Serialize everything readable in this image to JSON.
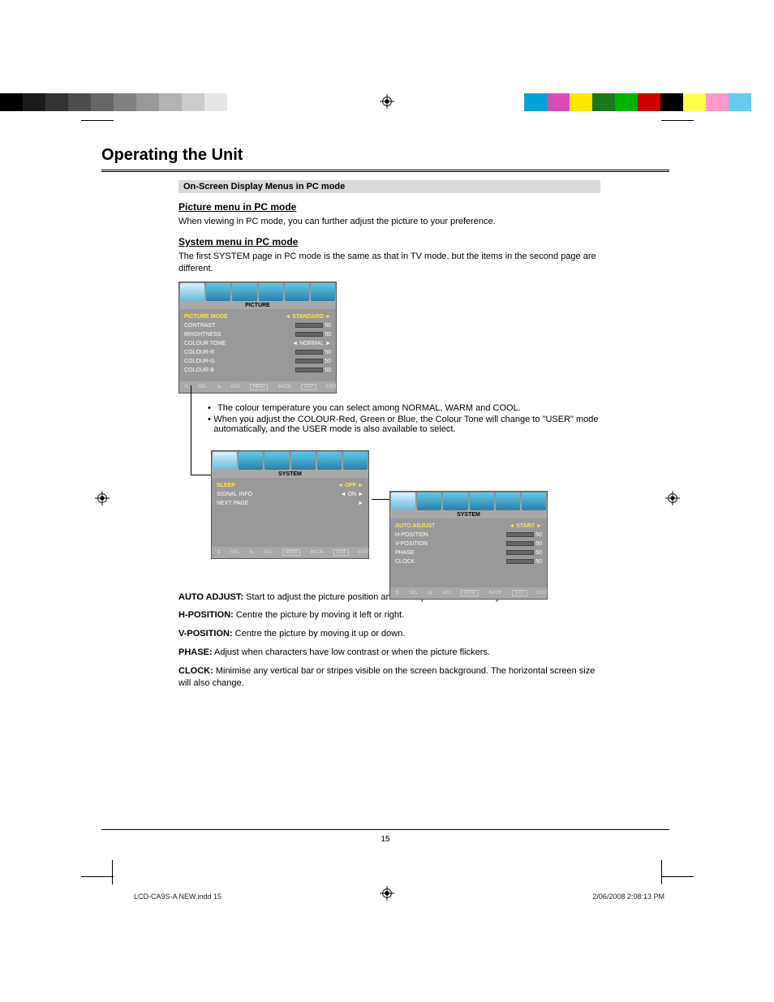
{
  "page": {
    "title": "Operating the Unit",
    "subtitle": "On-Screen Display Menus in PC mode",
    "section1": {
      "title": "Picture menu in PC mode",
      "intro": "When viewing in PC mode, you can further adjust the picture to your preference.",
      "osd": {
        "title": "PICTURE",
        "rows": [
          {
            "label": "PICTURE MODE",
            "type": "enum",
            "value": "STANDARD",
            "hl": true
          },
          {
            "label": "CONTRAST",
            "type": "slider",
            "value": "50"
          },
          {
            "label": "BRIGHTNESS",
            "type": "slider",
            "value": "50"
          },
          {
            "label": "COLOUR TONE",
            "type": "enum",
            "value": "NORMAL"
          },
          {
            "label": "COLOUR-R",
            "type": "slider",
            "value": "50"
          },
          {
            "label": "COLOUR-G",
            "type": "slider",
            "value": "50"
          },
          {
            "label": "COLOUR-B",
            "type": "slider",
            "value": "50"
          }
        ],
        "foot": [
          "SEL",
          "ADJ",
          "BACK",
          "EXIT"
        ],
        "footKeys": [
          "",
          "",
          "MENU",
          "EXIT"
        ]
      },
      "bullets": [
        "The colour temperature you can select among NORMAL, WARM and COOL.",
        "When you adjust the COLOUR-Red, Green or Blue, the Colour Tone will change to \"USER\" mode automatically, and the USER mode is also available to select."
      ]
    },
    "section2": {
      "title": "System menu in PC mode",
      "intro": "The first SYSTEM page in PC mode is the same as that in TV mode, but the items in the second page are different.",
      "osd2": {
        "title": "SYSTEM",
        "rows": [
          {
            "label": "SLEEP",
            "type": "enum",
            "value": "OFF",
            "hl": true
          },
          {
            "label": "SIGNAL INFO",
            "type": "enum",
            "value": "ON"
          },
          {
            "label": "NEXT PAGE",
            "type": "arrow",
            "value": ""
          }
        ],
        "foot": [
          "SEL",
          "ADJ",
          "BACK",
          "EXIT"
        ]
      },
      "osd3": {
        "title": "SYSTEM",
        "rows": [
          {
            "label": "AUTO ADJUST",
            "type": "enum",
            "value": "START",
            "hl": true
          },
          {
            "label": "H-POSITION",
            "type": "slider",
            "value": "50"
          },
          {
            "label": "V-POSITION",
            "type": "slider",
            "value": "50"
          },
          {
            "label": "PHASE",
            "type": "slider",
            "value": "50"
          },
          {
            "label": "CLOCK",
            "type": "slider",
            "value": "50"
          }
        ],
        "foot": [
          "SEL",
          "ADJ",
          "BACK",
          "EXIT"
        ]
      },
      "explain": [
        {
          "t": "AUTO ADJUST:",
          "d": "Start to adjust the picture position and clock phase automatically."
        },
        {
          "t": "H-POSITION:",
          "d": "Centre the picture by moving it left or right."
        },
        {
          "t": "V-POSITION:",
          "d": "Centre the picture by moving it up or down."
        },
        {
          "t": "PHASE:",
          "d": "Adjust when characters have low contrast or when the picture flickers."
        },
        {
          "t": "CLOCK:",
          "d": "Minimise any vertical bar or stripes visible on the screen background. The horizontal screen size will also change."
        }
      ]
    },
    "pageNum": "15"
  },
  "printFooter": {
    "file": "LCD-CA9S-A NEW.indd   15",
    "date": "2/06/2008   2:08:13 PM"
  },
  "colors": {
    "grays": [
      "#000000",
      "#1a1a1a",
      "#333333",
      "#4d4d4d",
      "#666666",
      "#808080",
      "#999999",
      "#b3b3b3",
      "#cccccc",
      "#e6e6e6",
      "#ffffff"
    ],
    "rgb": [
      "#00a3d9",
      "#d94db3",
      "#ffe600",
      "#1a7a1a",
      "#00b300",
      "#cc0000",
      "#000000",
      "#ffff4d",
      "#ff99cc",
      "#66ccee",
      "#ffffff"
    ]
  }
}
